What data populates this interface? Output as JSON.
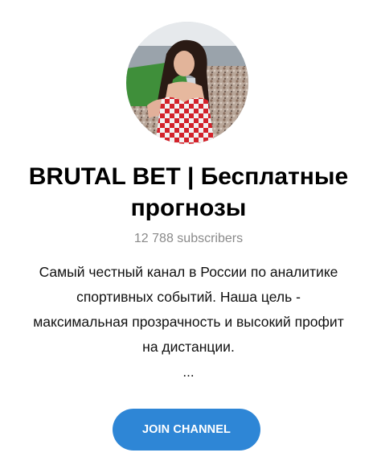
{
  "channel": {
    "avatar_icon": "channel-avatar-photo",
    "title_lines": [
      "BRUTAL BET | Бесплатные",
      "прогнозы"
    ],
    "subscribers": "12 788 subscribers",
    "description_lines": [
      "Самый честный канал в России по аналитике",
      "спортивных событий. Наша цель -",
      "максимальная прозрачность и высокий профит",
      "на дистанции."
    ],
    "more": "..."
  },
  "actions": {
    "join_label": "JOIN CHANNEL"
  },
  "colors": {
    "accent": "#2e86d6",
    "subtitle": "#8a8a8a",
    "text": "#000000"
  }
}
